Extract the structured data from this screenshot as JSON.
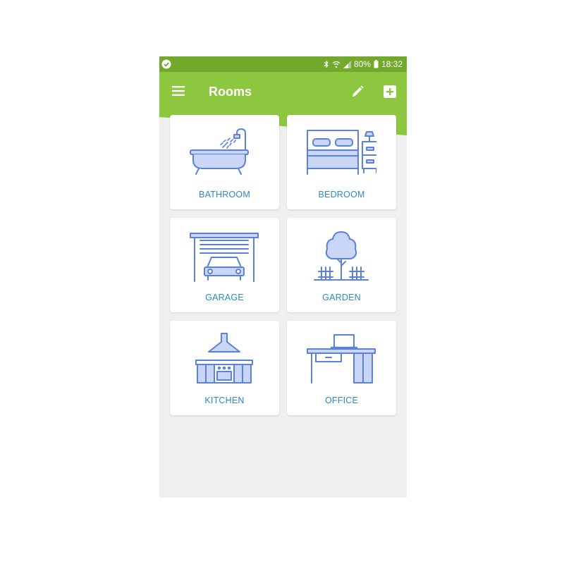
{
  "status_bar": {
    "battery": "80%",
    "time": "18:32",
    "icons": [
      "check-circle-icon",
      "bluetooth-icon",
      "wifi-icon",
      "signal-icon",
      "battery-icon"
    ]
  },
  "header": {
    "title": "Rooms",
    "icons": [
      "menu-icon",
      "edit-icon",
      "add-icon"
    ]
  },
  "rooms": [
    {
      "label": "BATHROOM",
      "icon": "bathtub-icon"
    },
    {
      "label": "BEDROOM",
      "icon": "bed-icon"
    },
    {
      "label": "GARAGE",
      "icon": "garage-icon"
    },
    {
      "label": "GARDEN",
      "icon": "tree-icon"
    },
    {
      "label": "KITCHEN",
      "icon": "kitchen-icon"
    },
    {
      "label": "OFFICE",
      "icon": "desk-icon"
    }
  ],
  "colors": {
    "status_bar": "#72a82c",
    "app_bar": "#8dc63f",
    "background": "#efefef",
    "card": "#ffffff",
    "label": "#2a89c7",
    "icon_stroke": "#5b82d6",
    "icon_fill": "#c9d6f5"
  }
}
